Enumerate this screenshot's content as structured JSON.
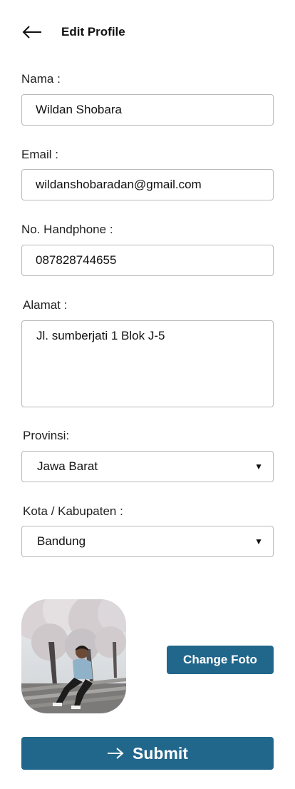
{
  "header": {
    "back_icon": "arrow-left-icon",
    "title": "Edit Profile"
  },
  "form": {
    "nama": {
      "label": "Nama :",
      "value": "Wildan Shobara"
    },
    "email": {
      "label": "Email :",
      "value": "wildanshobaradan@gmail.com"
    },
    "phone": {
      "label": "No. Handphone :",
      "value": "087828744655"
    },
    "alamat": {
      "label": "Alamat :",
      "value": "Jl. sumberjati 1 Blok J-5"
    },
    "provinsi": {
      "label": "Provinsi:",
      "value": "Jawa Barat",
      "caret": "▼"
    },
    "kota": {
      "label": "Kota / Kabupaten :",
      "value": "Bandung",
      "caret": "▼"
    }
  },
  "photo": {
    "change_label": "Change Foto"
  },
  "submit": {
    "icon": "arrow-right-icon",
    "label": "Submit"
  },
  "colors": {
    "primary": "#21668b",
    "border": "#b9b9b9"
  }
}
